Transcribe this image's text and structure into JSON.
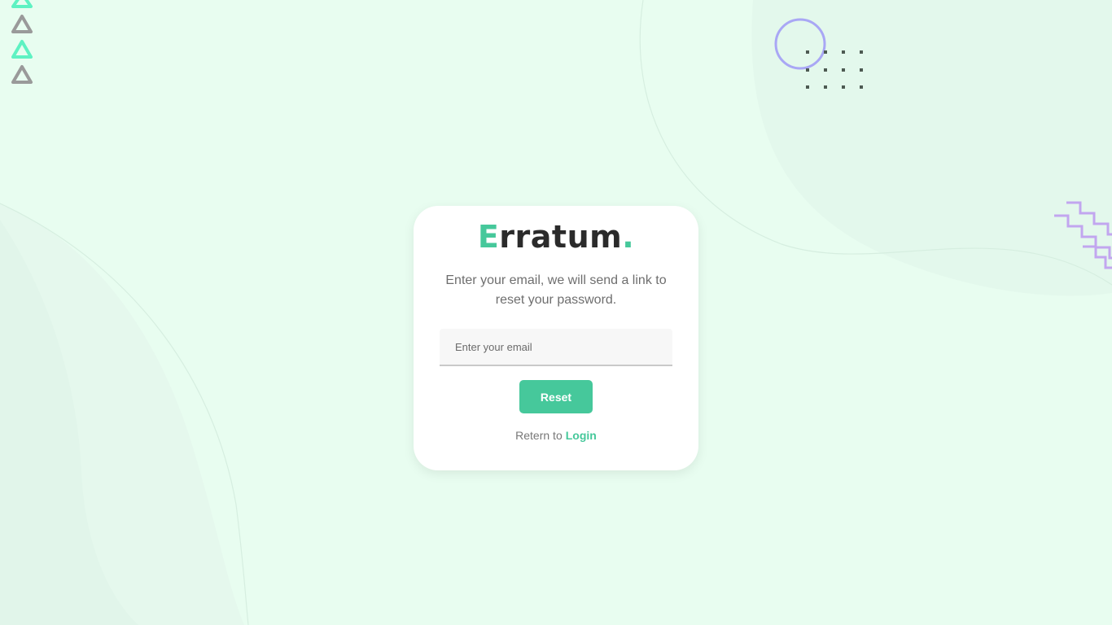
{
  "brand": {
    "first_letter": "E",
    "rest": "rratum",
    "dot": ".",
    "accent_color": "#46c89b"
  },
  "form": {
    "description": "Enter your email, we will send a link to reset your password.",
    "email_placeholder": "Enter your email",
    "reset_label": "Reset",
    "return_text": "Retern to",
    "login_link": "Login"
  },
  "icons": {
    "triangles": "triangle-outline-icon",
    "circle": "circle-outline-icon",
    "dots": "dot-grid-icon",
    "zigzag": "zigzag-icon"
  },
  "colors": {
    "background": "#e8fdf0",
    "card": "#ffffff",
    "button": "#46c89b",
    "triangle_green": "#5ef2c2",
    "triangle_gray": "#9a9a9a",
    "circle": "#a9a7f5",
    "zigzag": "#c2a6ef"
  }
}
